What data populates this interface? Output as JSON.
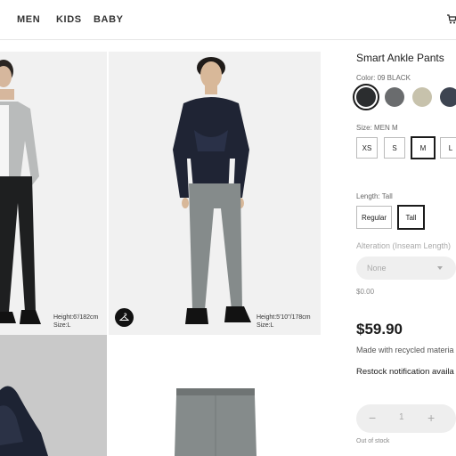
{
  "nav": {
    "men": "MEN",
    "kids": "KIDS",
    "baby": "BABY"
  },
  "gallery": {
    "caption_left": [
      "Height:6'/182cm",
      "Size:L"
    ],
    "caption_right": [
      "Height:5'10\"/178cm",
      "Size:L"
    ]
  },
  "product": {
    "title": "Smart Ankle Pants",
    "color_label": "Color: 09 BLACK",
    "colors": [
      "#2b2d2f",
      "#6a6c6e",
      "#c7c2ac",
      "#3d4451"
    ],
    "size_label": "Size: MEN M",
    "sizes": [
      "XS",
      "S",
      "M",
      "L"
    ],
    "length_label": "Length: Tall",
    "lengths": [
      "Regular",
      "Tall"
    ],
    "alteration_label": "Alteration (Inseam Length)",
    "alteration_value": "None",
    "alteration_price": "$0.00",
    "price": "$59.90",
    "recycled_note": "Made with recycled materia",
    "restock_note": "Restock notification availa",
    "quantity": "1",
    "minus": "−",
    "plus": "+",
    "stock_status": "Out of stock"
  }
}
